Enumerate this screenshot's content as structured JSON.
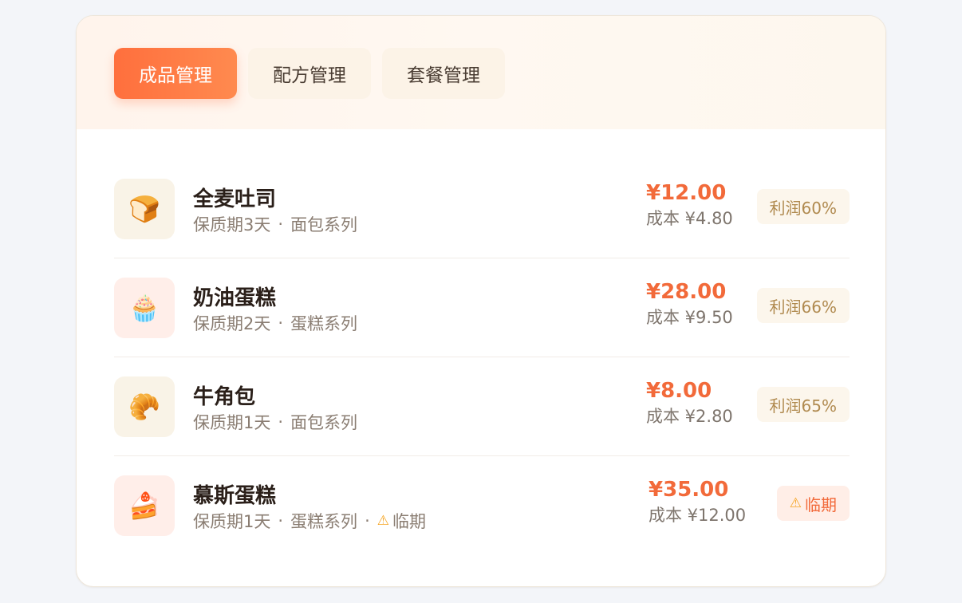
{
  "tabs": [
    {
      "label": "成品管理",
      "active": true
    },
    {
      "label": "配方管理",
      "active": false
    },
    {
      "label": "套餐管理",
      "active": false
    }
  ],
  "products": [
    {
      "icon": "bread-icon",
      "icon_glyph": "🍞",
      "thumb_color": "#f9f3e7",
      "name": "全麦吐司",
      "shelf_life": "保质期3天",
      "category": "面包系列",
      "price": "¥12.00",
      "cost": "成本 ¥4.80",
      "badge": "利润60%",
      "badge_type": "profit"
    },
    {
      "icon": "cupcake-icon",
      "icon_glyph": "🧁",
      "thumb_color": "#ffeee9",
      "name": "奶油蛋糕",
      "shelf_life": "保质期2天",
      "category": "蛋糕系列",
      "price": "¥28.00",
      "cost": "成本 ¥9.50",
      "badge": "利润66%",
      "badge_type": "profit"
    },
    {
      "icon": "croissant-icon",
      "icon_glyph": "🥐",
      "thumb_color": "#f9f3e7",
      "name": "牛角包",
      "shelf_life": "保质期1天",
      "category": "面包系列",
      "price": "¥8.00",
      "cost": "成本 ¥2.80",
      "badge": "利润65%",
      "badge_type": "profit"
    },
    {
      "icon": "cake-slice-icon",
      "icon_glyph": "🍰",
      "thumb_color": "#ffeee9",
      "name": "慕斯蛋糕",
      "shelf_life": "保质期1天",
      "category": "蛋糕系列",
      "meta_warning": "临期",
      "price": "¥35.00",
      "cost": "成本 ¥12.00",
      "badge": "临期",
      "badge_type": "expiring"
    }
  ]
}
